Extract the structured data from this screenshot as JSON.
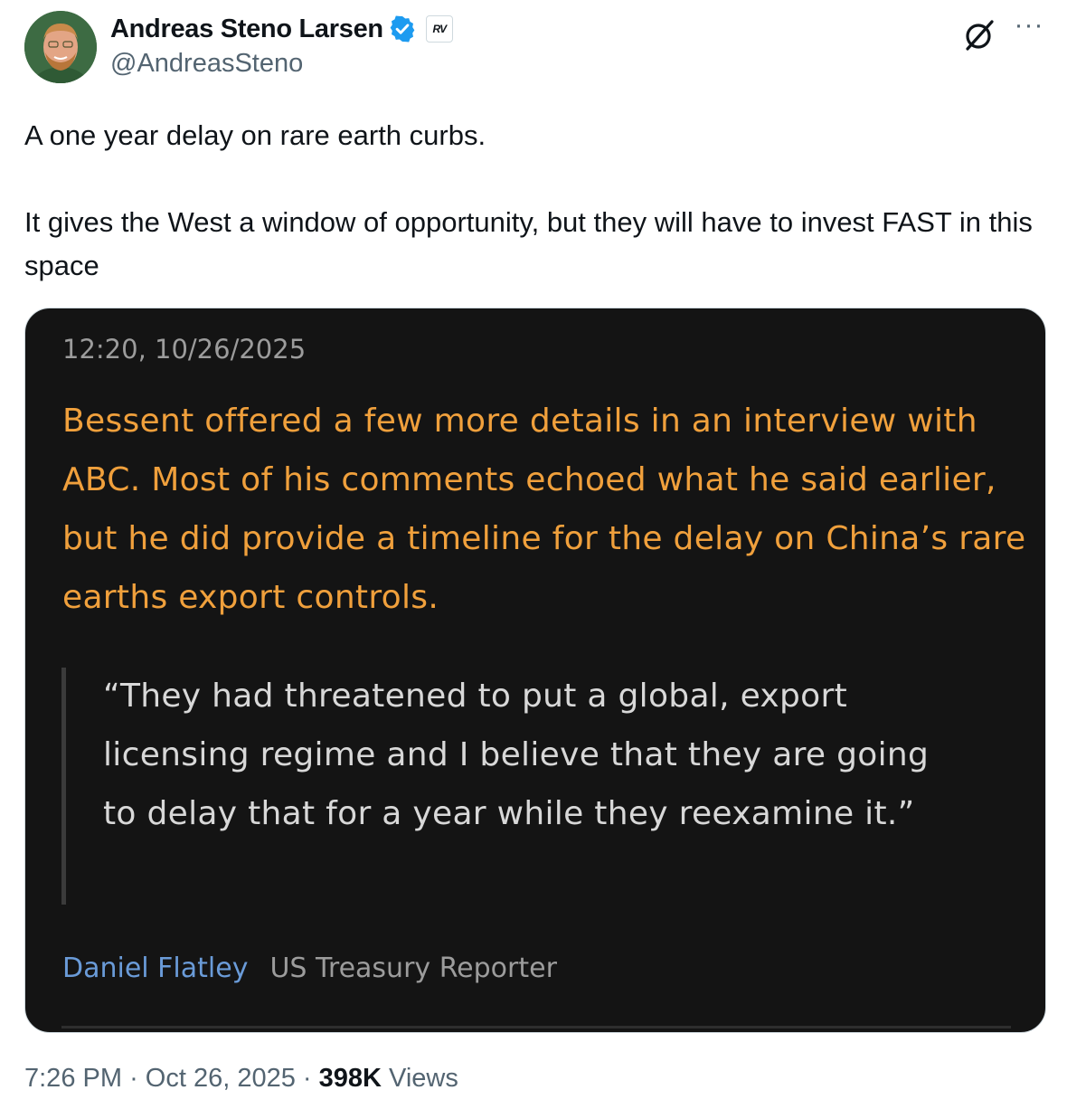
{
  "author": {
    "display_name": "Andreas Steno Larsen",
    "handle": "@AndreasSteno",
    "verified_icon": "verified-badge-icon",
    "affiliation_badge": "RV",
    "brand_color": "#1d9bf0"
  },
  "tweet": {
    "paragraphs": [
      "A one year delay on rare earth curbs.",
      "It gives the West a window of opportunity, but they will have to invest FAST in this space"
    ]
  },
  "media": {
    "timestamp": "12:20, 10/26/2025",
    "headline": "Bessent offered a few more details in an interview with ABC. Most of his comments echoed what he said earlier, but he did provide a timeline for the delay on China’s rare earths export controls.",
    "quote": "“They had threatened to put a global, export licensing regime and I believe that they are going to delay that for a year while they reexamine it.”",
    "byline_author": "Daniel Flatley",
    "byline_role": "US Treasury Reporter",
    "colors": {
      "background": "#141414",
      "headline": "#f0a03c",
      "author_link": "#6a9bd8"
    }
  },
  "footer": {
    "time": "7:26 PM",
    "separator": "·",
    "date": "Oct 26, 2025",
    "views_count": "398K",
    "views_label": "Views"
  },
  "icons": {
    "top_right_1": "grok-icon",
    "top_right_2": "more-options-icon"
  }
}
